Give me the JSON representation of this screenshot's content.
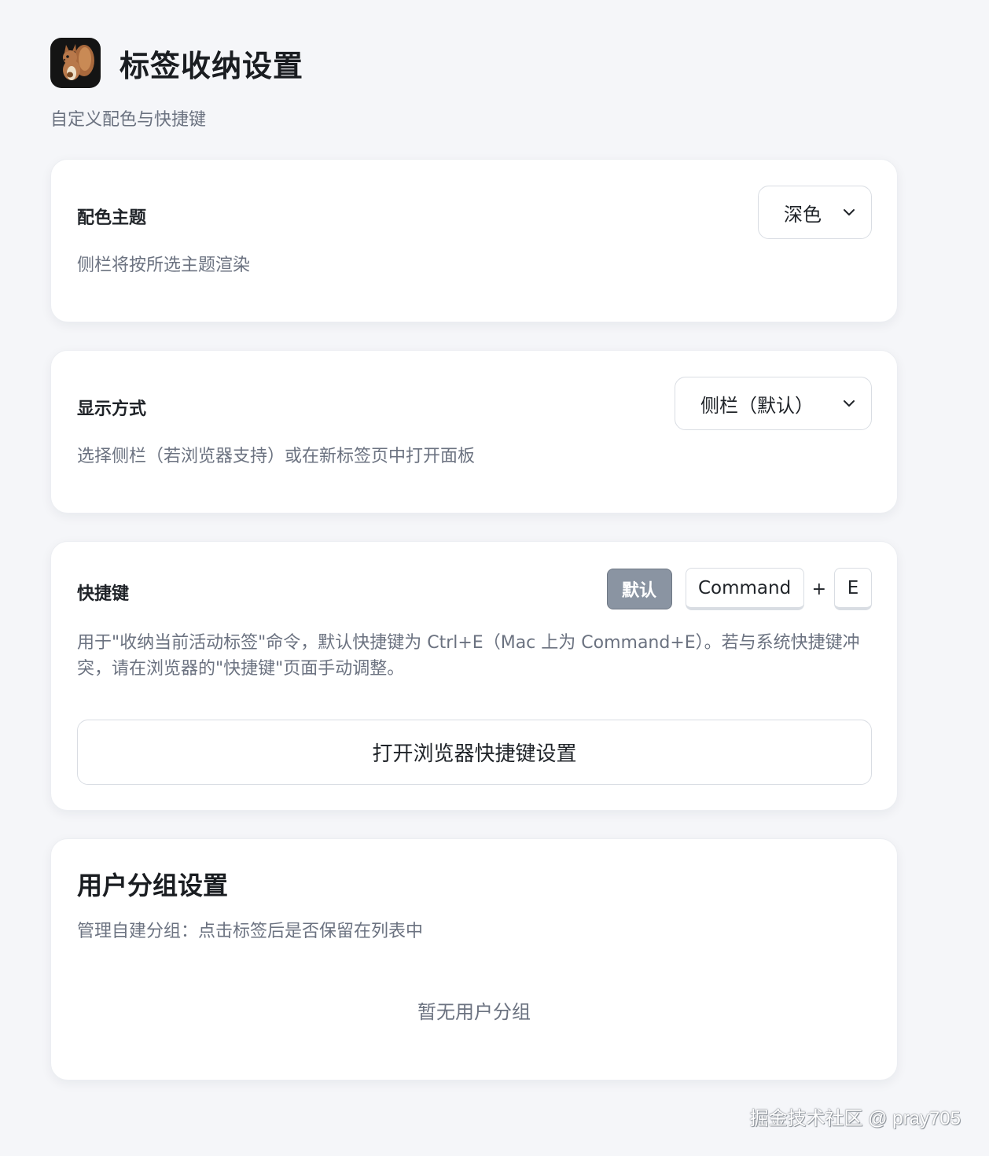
{
  "header": {
    "title": "标签收纳设置",
    "subtitle": "自定义配色与快捷键"
  },
  "theme": {
    "label": "配色主题",
    "description": "侧栏将按所选主题渲染",
    "selected": "深色"
  },
  "display": {
    "label": "显示方式",
    "description": "选择侧栏（若浏览器支持）或在新标签页中打开面板",
    "selected": "侧栏（默认）"
  },
  "shortcut": {
    "label": "快捷键",
    "default_button": "默认",
    "modifier": "Command",
    "plus": "+",
    "key": "E",
    "description": "用于\"收纳当前活动标签\"命令，默认快捷键为 Ctrl+E（Mac 上为 Command+E）。若与系统快捷键冲突，请在浏览器的\"快捷键\"页面手动调整。",
    "open_settings_button": "打开浏览器快捷键设置"
  },
  "groups": {
    "title": "用户分组设置",
    "description": "管理自建分组：点击标签后是否保留在列表中",
    "empty": "暂无用户分组"
  },
  "watermark": "掘金技术社区 @ pray705"
}
